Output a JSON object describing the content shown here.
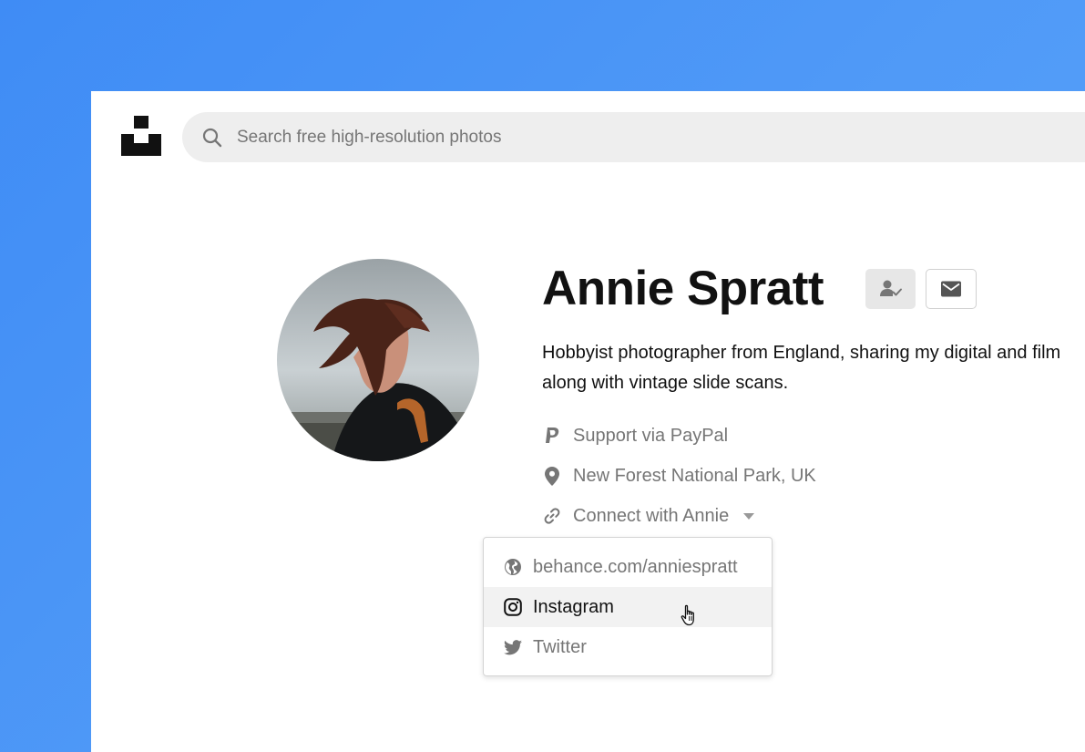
{
  "header": {
    "logo_icon": "unsplash-logo-icon",
    "search": {
      "icon": "search-icon",
      "placeholder": "Search free high-resolution photos",
      "value": ""
    }
  },
  "profile": {
    "name": "Annie Spratt",
    "avatar_icon": "profile-photo-avatar",
    "actions": {
      "follow_icon": "follow-user-icon",
      "message_icon": "mail-icon"
    },
    "bio": {
      "line1": "Hobbyist photographer from England, sharing my digital and film",
      "line2": "along with vintage slide scans."
    },
    "links": {
      "paypal": {
        "icon": "paypal-icon",
        "label": "Support via PayPal"
      },
      "location": {
        "icon": "location-pin-icon",
        "label": "New Forest National Park, UK"
      },
      "connect": {
        "icon": "link-icon",
        "label": "Connect with Annie",
        "caret_icon": "caret-down-icon"
      }
    }
  },
  "connect_menu": {
    "items": [
      {
        "icon": "globe-icon",
        "label": "behance.com/anniespratt",
        "active": false
      },
      {
        "icon": "instagram-icon",
        "label": "Instagram",
        "active": true
      },
      {
        "icon": "twitter-icon",
        "label": "Twitter",
        "active": false
      }
    ]
  },
  "colors": {
    "background_gradient_start": "#3f8cf5",
    "background_gradient_end": "#5aa5fa",
    "text_primary": "#111111",
    "text_secondary": "#767676",
    "search_bg": "#eeeeee",
    "menu_hover_bg": "#f2f2f2"
  }
}
